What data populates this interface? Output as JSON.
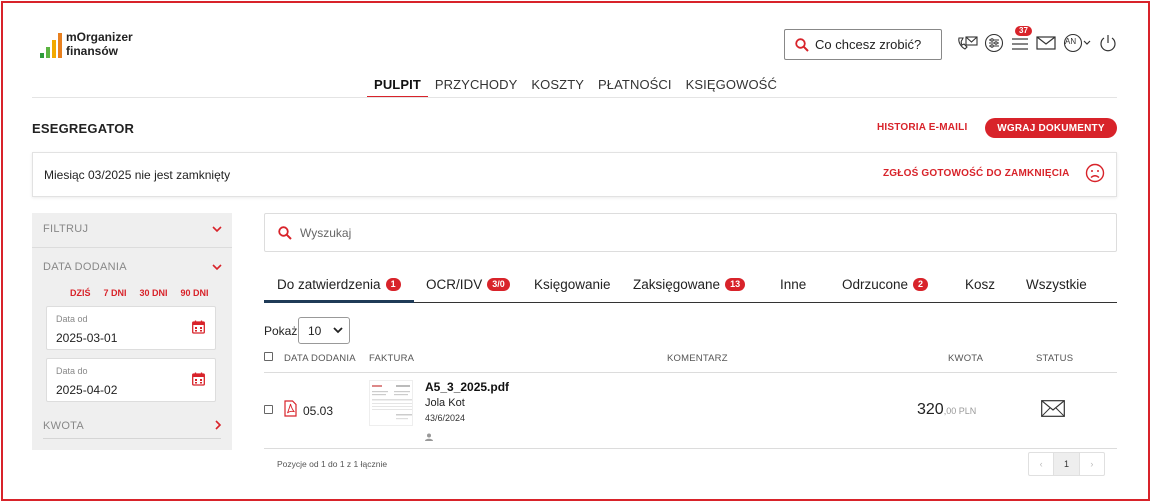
{
  "app": {
    "logo_line1": "mOrganizer",
    "logo_line2": "finansów",
    "logo_bar_colors": [
      "#2e9c3a",
      "#5bb441",
      "#f2a900",
      "#e8801e"
    ]
  },
  "header": {
    "search_placeholder": "Co chcesz zrobić?",
    "notifications_count": "37",
    "user_initials": "AN"
  },
  "topnav": {
    "items": [
      "PULPIT",
      "PRZYCHODY",
      "KOSZTY",
      "PŁATNOŚCI",
      "KSIĘGOWOŚĆ"
    ],
    "active": "PULPIT"
  },
  "section": {
    "title": "ESEGREGATOR",
    "history_link": "HISTORIA E-MAILI",
    "upload_button": "WGRAJ DOKUMENTY"
  },
  "month_bar": {
    "message": "Miesiąc 03/2025 nie jest zamknięty",
    "report_link": "ZGŁOŚ GOTOWOŚĆ DO ZAMKNIĘCIA"
  },
  "sidebar": {
    "filter_label": "FILTRUJ",
    "date_added_label": "DATA DODANIA",
    "quick_ranges": [
      "DZIŚ",
      "7 DNI",
      "30 DNI",
      "90 DNI"
    ],
    "date_from": {
      "label": "Data od",
      "value": "2025-03-01"
    },
    "date_to": {
      "label": "Data do",
      "value": "2025-04-02"
    },
    "amount_label": "KWOTA"
  },
  "main": {
    "search_placeholder": "Wyszukaj",
    "tabs": [
      {
        "label": "Do zatwierdzenia",
        "badge": "1"
      },
      {
        "label": "OCR/IDV",
        "badge": "3/0"
      },
      {
        "label": "Księgowanie",
        "badge": ""
      },
      {
        "label": "Zaksięgowane",
        "badge": "13"
      },
      {
        "label": "Inne",
        "badge": ""
      },
      {
        "label": "Odrzucone",
        "badge": "2"
      },
      {
        "label": "Kosz",
        "badge": ""
      },
      {
        "label": "Wszystkie",
        "badge": ""
      }
    ],
    "active_tab": "Do zatwierdzenia",
    "show_label": "Pokaż",
    "page_size": "10",
    "columns": [
      "DATA DODANIA",
      "FAKTURA",
      "KOMENTARZ",
      "KWOTA",
      "STATUS"
    ],
    "rows": [
      {
        "date": "05.03",
        "file_name": "A5_3_2025.pdf",
        "person": "Jola Kot",
        "doc_number": "43/6/2024",
        "comment": "",
        "amount_main": "320",
        "amount_rest": ",00 PLN",
        "status_icon": "envelope-icon"
      }
    ],
    "footer_info": "Pozycje od 1 do 1 z 1 łącznie",
    "pagination": {
      "prev": "‹",
      "current": "1",
      "next": "›"
    }
  },
  "colors": {
    "accent": "#d8232a",
    "tab_underline": "#1f3b57",
    "sidebar_bg": "#efefef"
  }
}
